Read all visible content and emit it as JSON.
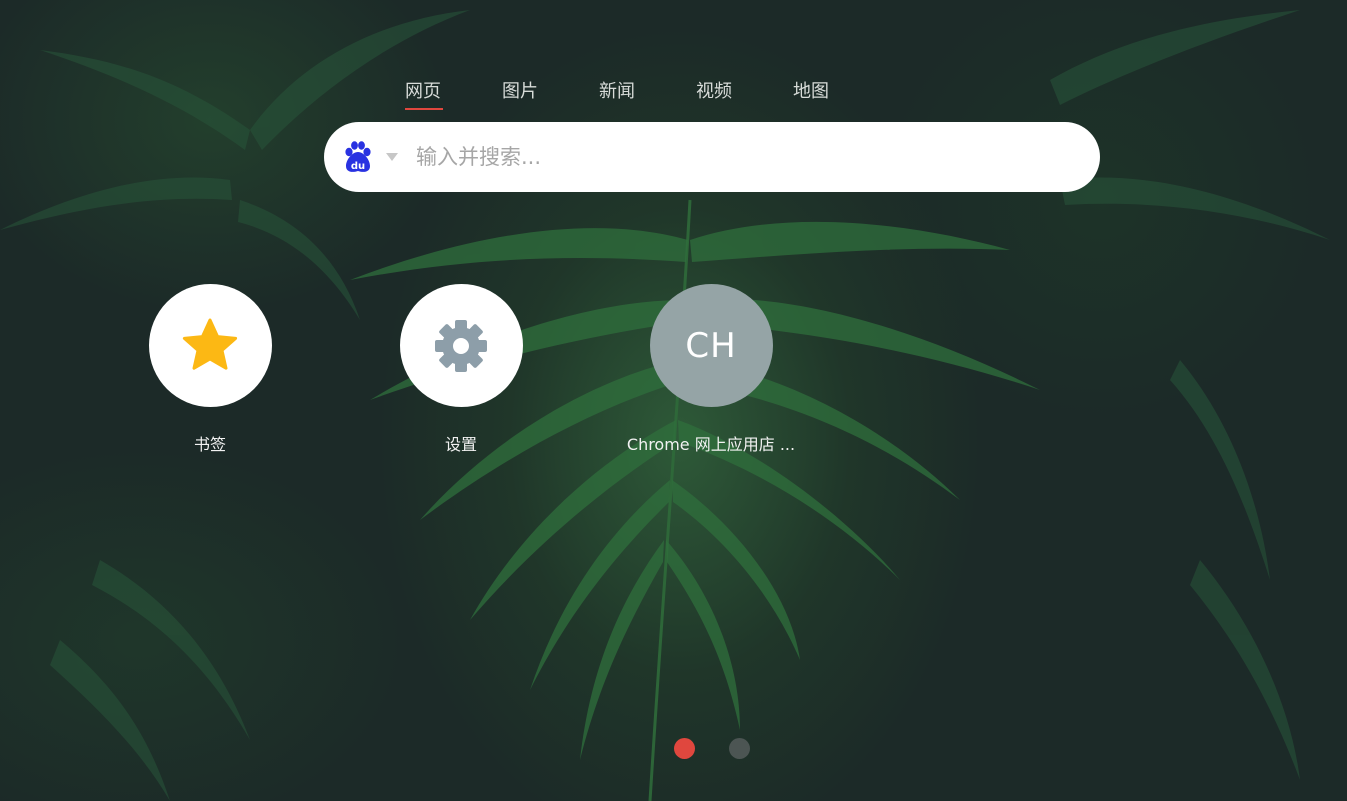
{
  "tabs": [
    {
      "label": "网页",
      "active": true
    },
    {
      "label": "图片",
      "active": false
    },
    {
      "label": "新闻",
      "active": false
    },
    {
      "label": "视频",
      "active": false
    },
    {
      "label": "地图",
      "active": false
    }
  ],
  "search": {
    "engine_icon": "baidu-paw-icon",
    "placeholder": "输入并搜索...",
    "value": ""
  },
  "shortcuts": [
    {
      "label": "书签",
      "icon": "star-icon"
    },
    {
      "label": "设置",
      "icon": "gear-icon"
    },
    {
      "label": "Chrome 网上应用店 ...",
      "initials": "CH"
    }
  ],
  "pagination": {
    "pages": 2,
    "current": 1
  },
  "colors": {
    "accent": "#e0473e",
    "star": "#fcb814",
    "gear": "#8d9ea9",
    "baidu_blue": "#2932e1",
    "dot_inactive": "#4c5553",
    "chrome_tile": "#95a4a6"
  }
}
